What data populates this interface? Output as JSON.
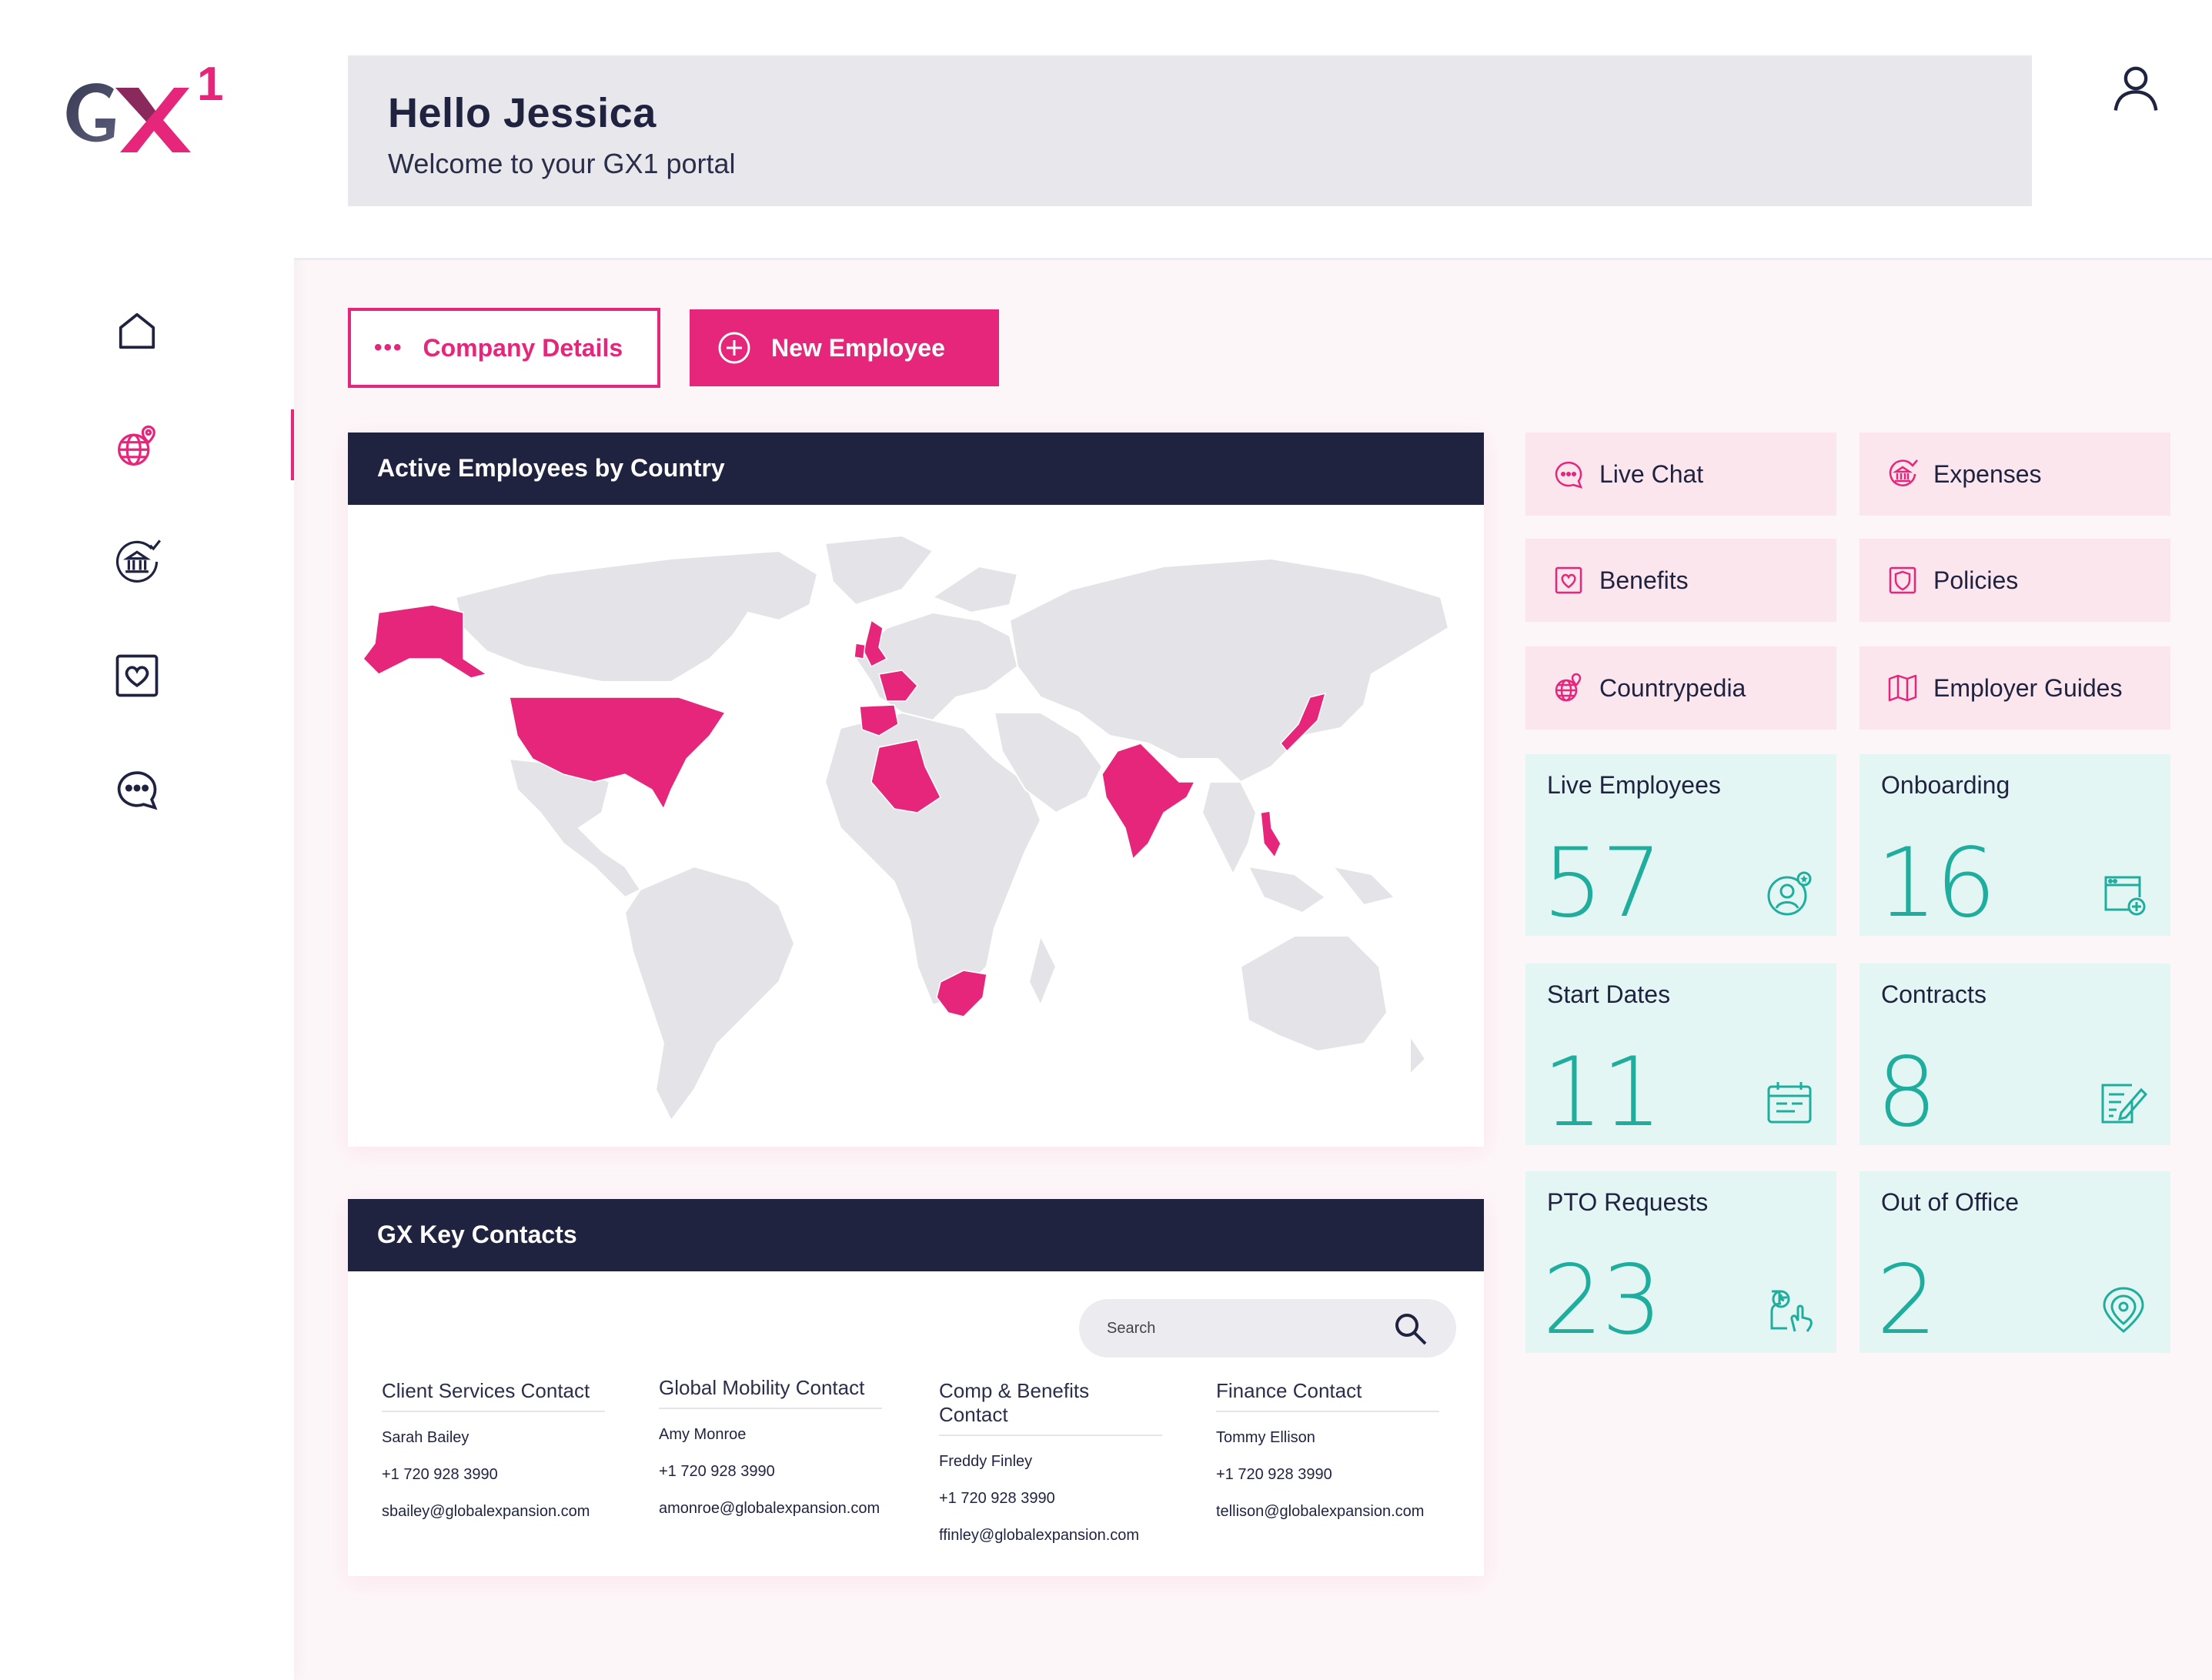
{
  "brand": {
    "logo_letters": "GX",
    "logo_super": "1",
    "accent": "#e6267a",
    "navy": "#1f2340",
    "teal": "#1fae9e"
  },
  "header": {
    "title": "Hello Jessica",
    "subtitle": "Welcome to your GX1 portal"
  },
  "sidebar": {
    "items": [
      {
        "icon": "home-icon"
      },
      {
        "icon": "globe-pin-icon",
        "active": true
      },
      {
        "icon": "bank-check-icon"
      },
      {
        "icon": "heart-box-icon"
      },
      {
        "icon": "chat-bubble-icon"
      }
    ]
  },
  "actions": {
    "company_details": "Company Details",
    "new_employee": "New Employee"
  },
  "map": {
    "title": "Active Employees by Country",
    "highlighted": [
      "United States",
      "Alaska",
      "United Kingdom",
      "Ireland",
      "Spain",
      "Algeria",
      "India",
      "Japan",
      "Philippines",
      "South Africa"
    ]
  },
  "contacts": {
    "title": "GX Key Contacts",
    "search_placeholder": "Search",
    "columns": [
      {
        "title": "Client Services Contact",
        "name": "Sarah Bailey",
        "phone": "+1 720 928 3990",
        "email": "sbailey@globalexpansion.com"
      },
      {
        "title": "Global Mobility Contact",
        "name": "Amy Monroe",
        "phone": "+1 720 928 3990",
        "email": "amonroe@globalexpansion.com"
      },
      {
        "title": "Comp & Benefits Contact",
        "name": "Freddy Finley",
        "phone": "+1 720 928 3990",
        "email": "ffinley@globalexpansion.com"
      },
      {
        "title": "Finance Contact",
        "name": "Tommy Ellison",
        "phone": "+1 720 928 3990",
        "email": "tellison@globalexpansion.com"
      }
    ]
  },
  "quick_links": [
    {
      "label": "Live Chat",
      "icon": "chat-icon"
    },
    {
      "label": "Expenses",
      "icon": "bank-icon"
    },
    {
      "label": "Benefits",
      "icon": "heart-icon"
    },
    {
      "label": "Policies",
      "icon": "shield-icon"
    },
    {
      "label": "Countrypedia",
      "icon": "globe-icon"
    },
    {
      "label": "Employer Guides",
      "icon": "map-icon"
    }
  ],
  "stats": [
    {
      "label": "Live Employees",
      "value": "57",
      "icon": "user-star-icon"
    },
    {
      "label": "Onboarding",
      "value": "16",
      "icon": "window-plus-icon"
    },
    {
      "label": "Start Dates",
      "value": "11",
      "icon": "calendar-icon"
    },
    {
      "label": "Contracts",
      "value": "8",
      "icon": "contract-pen-icon"
    },
    {
      "label": "PTO Requests",
      "value": "23",
      "icon": "clock-hand-icon"
    },
    {
      "label": "Out of Office",
      "value": "2",
      "icon": "location-pin-icon"
    }
  ]
}
